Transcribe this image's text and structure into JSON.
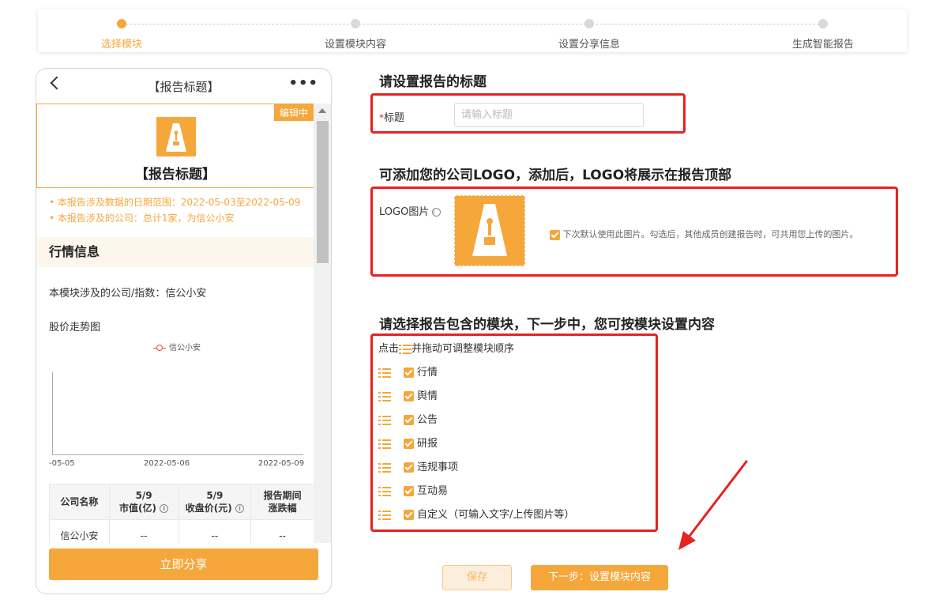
{
  "stepper": {
    "steps": [
      {
        "label": "选择模块",
        "active": true
      },
      {
        "label": "设置模块内容",
        "active": false
      },
      {
        "label": "设置分享信息",
        "active": false
      },
      {
        "label": "生成智能报告",
        "active": false
      }
    ]
  },
  "phone": {
    "title": "【报告标题】",
    "more": "•••",
    "edit_badge": "编辑中",
    "report_title": "【报告标题】",
    "bullets": [
      "本报告涉及数据的日期范围：2022-05-03至2022-05-09",
      "本报告涉及的公司：总计1家，为信公小安"
    ],
    "section_title": "行情信息",
    "module_companies": "本模块涉及的公司/指数：信公小安",
    "chart_title": "股价走势图",
    "chart_data": {
      "type": "line",
      "series": [
        {
          "name": "信公小安",
          "values": []
        }
      ],
      "x_tick_labels": [
        "-05-05",
        "2022-05-06",
        "2022-05-09"
      ]
    },
    "table": {
      "headers": [
        [
          "公司名称"
        ],
        [
          "5/9",
          "市值(亿)"
        ],
        [
          "5/9",
          "收盘价(元)"
        ],
        [
          "报告期间",
          "涨跌幅"
        ]
      ],
      "rows": [
        [
          "信公小安",
          "--",
          "--",
          "--"
        ]
      ]
    },
    "share_button": "立即分享"
  },
  "form": {
    "title_section_heading": "请设置报告的标题",
    "title_required_mark": "*",
    "title_label": "标题",
    "title_placeholder": "请输入标题",
    "title_value": "",
    "logo_section_heading": "可添加您的公司LOGO，添加后，LOGO将展示在报告顶部",
    "logo_label": "LOGO图片",
    "logo_default_note": "下次默认使用此图片。勾选后，其他成员创建报告时，可共用您上传的图片。",
    "logo_default_checked": true,
    "modules_section_heading": "请选择报告包含的模块，下一步中，您可按模块设置内容",
    "modules_hint_prefix": "点击",
    "modules_hint_suffix": "并拖动可调整模块顺序",
    "modules": [
      {
        "label": "行情",
        "checked": true
      },
      {
        "label": "舆情",
        "checked": true
      },
      {
        "label": "公告",
        "checked": true
      },
      {
        "label": "研报",
        "checked": true
      },
      {
        "label": "违规事项",
        "checked": true
      },
      {
        "label": "互动易",
        "checked": true
      },
      {
        "label": "自定义（可输入文字/上传图片等）",
        "checked": true
      }
    ]
  },
  "actions": {
    "save_label": "保存",
    "next_label": "下一步：设置模块内容"
  },
  "colors": {
    "accent": "#f5a73c",
    "annotation_red": "#e82121"
  }
}
